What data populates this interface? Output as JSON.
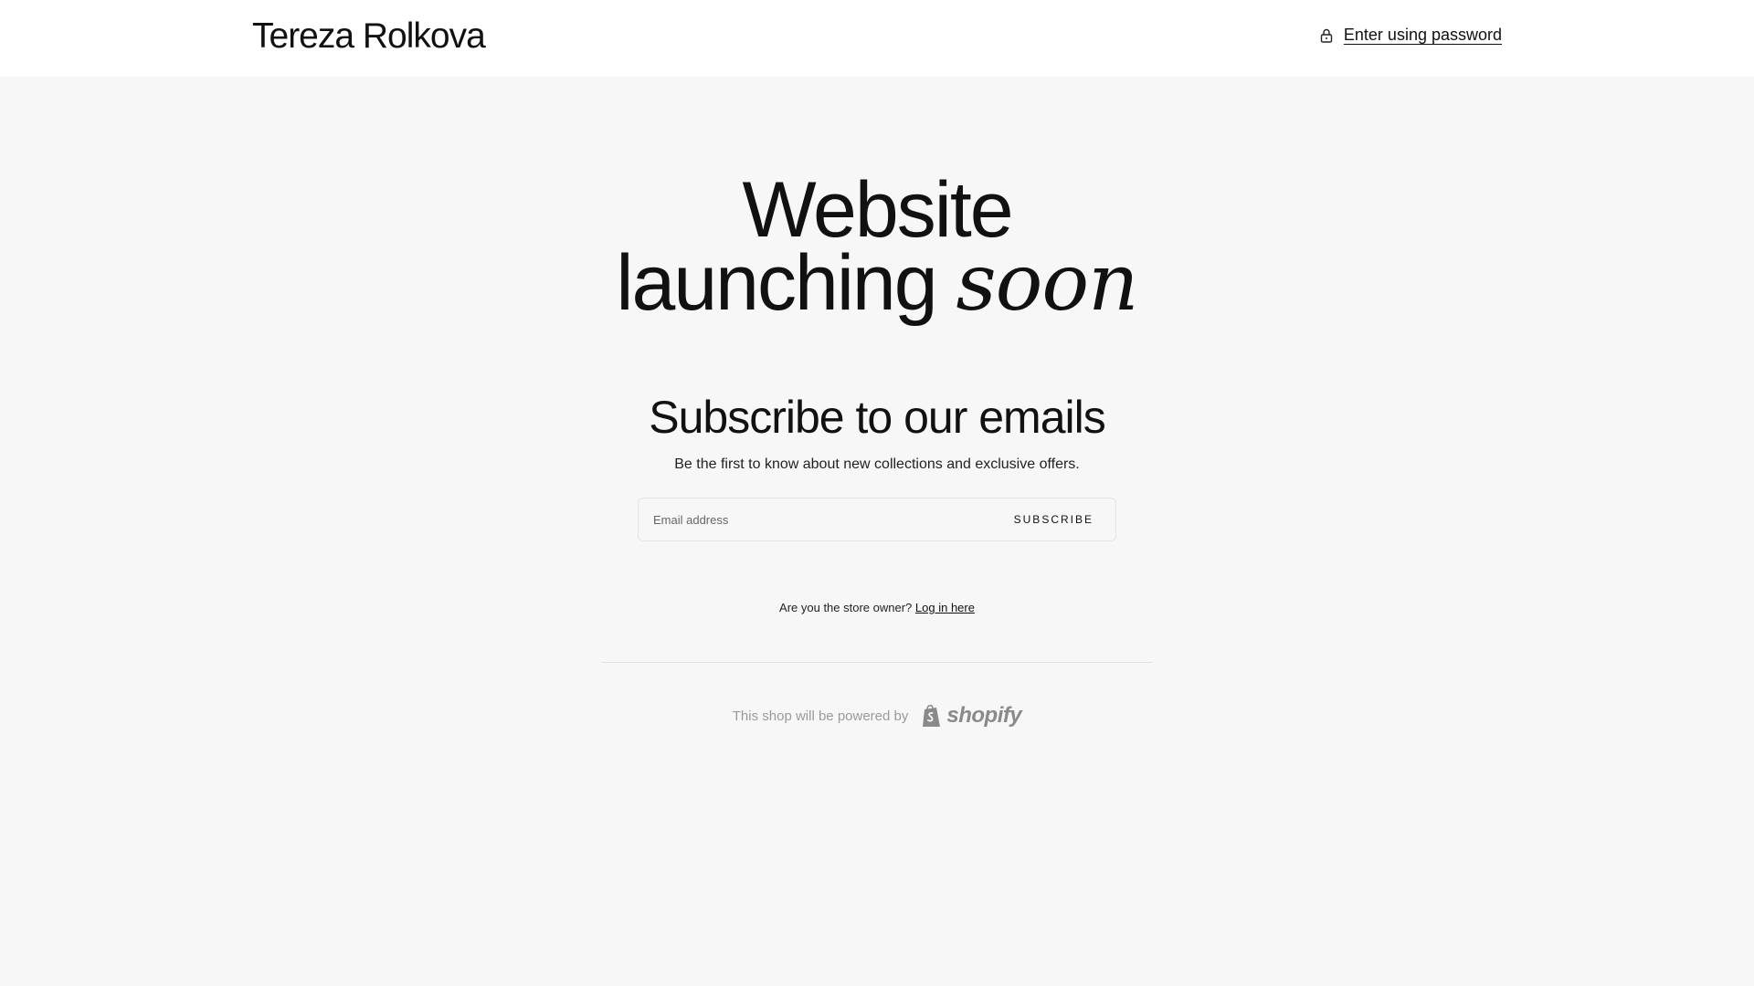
{
  "header": {
    "brand": "Tereza Rolkova",
    "password_link": "Enter using password",
    "lock_icon": "lock-icon"
  },
  "hero": {
    "line1": "Website",
    "line2": "launching",
    "accent": "soon"
  },
  "subscribe": {
    "title": "Subscribe to our emails",
    "subtitle": "Be the first to know about new collections and exclusive offers.",
    "email_placeholder": "Email address",
    "email_value": "",
    "button_label": "SUBSCRIBE"
  },
  "owner": {
    "question": "Are you the store owner?",
    "login_link": "Log in here"
  },
  "footer": {
    "powered_by": "This shop will be powered by",
    "logo_word": "shopify",
    "logo_icon": "shopify-bag-icon"
  }
}
